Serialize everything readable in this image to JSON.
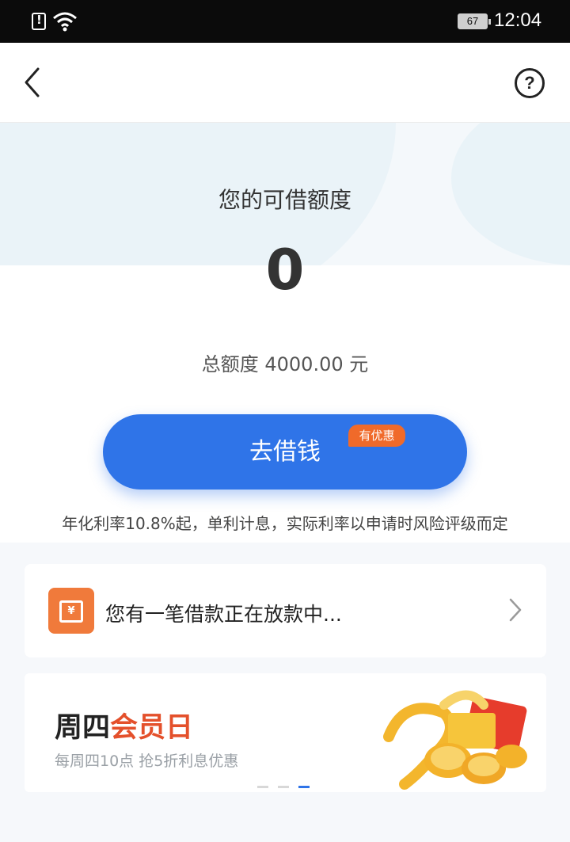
{
  "status_bar": {
    "battery": "67",
    "time": "12:04"
  },
  "nav": {
    "back_icon": "chevron-left-icon",
    "help_icon": "question-circle-icon",
    "help_glyph": "?"
  },
  "credit": {
    "title": "您的可借额度",
    "amount": "0",
    "total": "总额度 4000.00 元"
  },
  "borrow_button": {
    "label": "去借钱",
    "badge": "有优惠"
  },
  "rate_note": "年化利率10.8%起，单利计息，实际利率以申请时风险评级而定",
  "loan_status": {
    "icon": "yuan-box-icon",
    "icon_glyph": "¥",
    "message": "您有一笔借款正在放款中..."
  },
  "banner": {
    "title_part1": "周四",
    "title_part2": "会员日",
    "subtitle": "每周四10点 抢5折利息优惠",
    "active_dot": 3
  },
  "colors": {
    "primary": "#2f74e8",
    "accent": "#e4502b",
    "badge": "#f06a2a"
  }
}
